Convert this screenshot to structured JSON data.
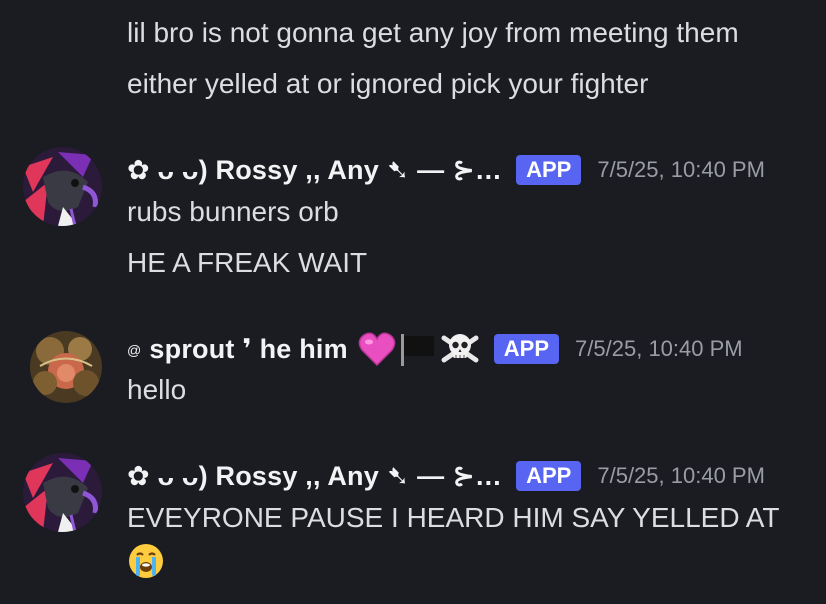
{
  "messages": {
    "continuation": {
      "lines": [
        "lil bro is not gonna get any joy from meeting them",
        "either yelled at or ignored pick your fighter"
      ]
    },
    "m1": {
      "username": "✿ ᴗ ᴗ) Rossy  ,,  Any ➷ — ⊱…",
      "badge": "APP",
      "timestamp": "7/5/25, 10:40 PM",
      "lines": [
        "rubs bunners orb",
        "HE A FREAK WAIT"
      ]
    },
    "m2": {
      "username_prefix": "@",
      "username": "sprout ❜ he him",
      "badge": "APP",
      "timestamp": "7/5/25, 10:40 PM",
      "lines": [
        "hello"
      ]
    },
    "m3": {
      "username": "✿ ᴗ ᴗ) Rossy  ,,  Any ➷ — ⊱…",
      "badge": "APP",
      "timestamp": "7/5/25, 10:40 PM",
      "lines": [
        "EVEYRONE PAUSE I HEARD HIM SAY YELLED AT"
      ]
    }
  },
  "icons": {
    "m2_emojis": [
      "pink-heart-icon",
      "black-flag-icon",
      "skull-crossbones-icon"
    ],
    "m3_emoji": "loudly-crying-face-icon"
  },
  "colors": {
    "background": "#1b1c21",
    "text": "#dcdde2",
    "username": "#f2f3f5",
    "badge": "#5865f2",
    "timestamp": "#9a9ca6"
  }
}
